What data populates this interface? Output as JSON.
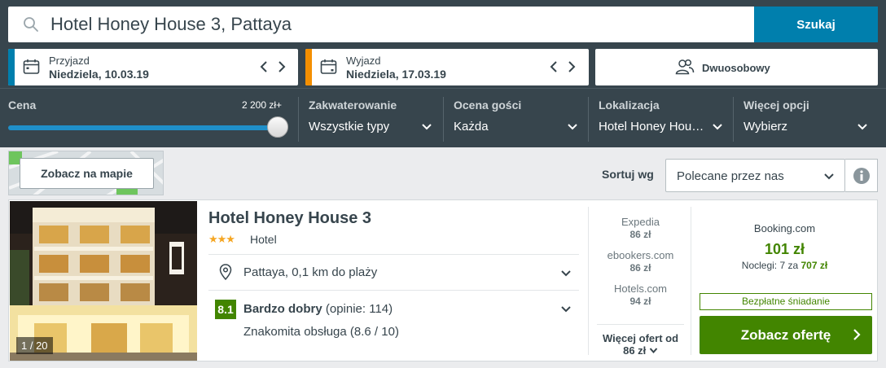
{
  "search": {
    "query": "Hotel Honey House 3, Pattaya",
    "button_label": "Szukaj",
    "icon": "search-icon"
  },
  "checkin": {
    "label": "Przyjazd",
    "value": "Niedziela, 10.03.19",
    "accent": "#007fad"
  },
  "checkout": {
    "label": "Wyjazd",
    "value": "Niedziela, 17.03.19",
    "accent": "#f48f00"
  },
  "room": {
    "label": "Dwuosobowy",
    "icon": "people-icon"
  },
  "filters": {
    "price": {
      "title": "Cena",
      "max_label": "2 200 zł+",
      "slider_level": 1.0
    },
    "accommodation": {
      "title": "Zakwaterowanie",
      "value": "Wszystkie typy"
    },
    "guest_rating": {
      "title": "Ocena gości",
      "value": "Każda"
    },
    "location": {
      "title": "Lokalizacja",
      "value": "Hotel Honey Hou…"
    },
    "more": {
      "title": "Więcej opcji",
      "value": "Wybierz"
    }
  },
  "map": {
    "button_label": "Zobacz na mapie"
  },
  "sort": {
    "label": "Sortuj wg",
    "value": "Polecane przez nas"
  },
  "result": {
    "photo_counter": "1 / 20",
    "name": "Hotel Honey House 3",
    "stars": "★★★",
    "type": "Hotel",
    "location": "Pattaya, 0,1 km do plaży",
    "score": "8.1",
    "rating_label": "Bardzo dobry",
    "reviews": "(opinie: 114)",
    "service": "Znakomita obsługa (8.6 / 10)",
    "offers": [
      {
        "site": "Expedia",
        "price": "86 zł"
      },
      {
        "site": "ebookers.com",
        "price": "86 zł"
      },
      {
        "site": "Hotels.com",
        "price": "94 zł"
      }
    ],
    "more_offers_label": "Więcej ofert od",
    "more_offers_price": "86 zł",
    "best": {
      "site": "Booking.com",
      "price": "101 zł",
      "nights_label": "Noclegi: 7 za",
      "nights_total": "707 zł",
      "badge": "Bezpłatne śniadanie",
      "cta": "Zobacz ofertę"
    }
  },
  "colors": {
    "header_bg": "#37454d",
    "primary_blue": "#007fad",
    "success_green": "#428500",
    "star_orange": "#f5a623"
  }
}
